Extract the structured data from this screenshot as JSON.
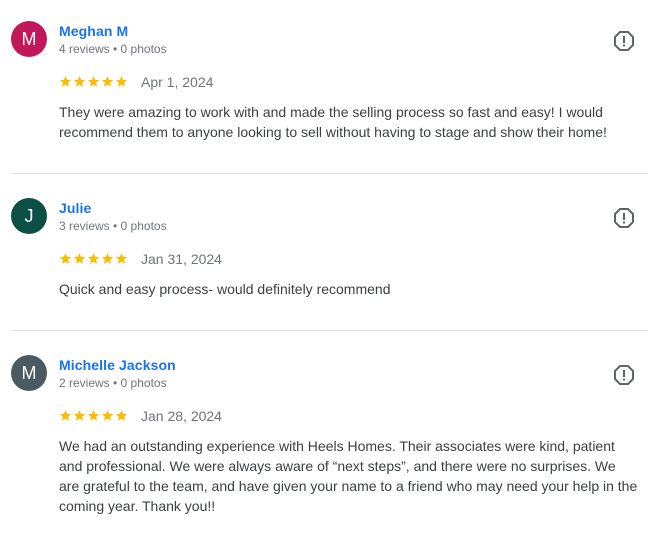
{
  "reviews": [
    {
      "initial": "M",
      "avatar_color": "#c2185b",
      "name": "Meghan M",
      "meta": "4 reviews • 0 photos",
      "rating": 5,
      "date": "Apr 1, 2024",
      "text": "They were amazing to work with and made the selling process so fast and easy! I would recommend them to anyone looking to sell without having to stage and show their home!"
    },
    {
      "initial": "J",
      "avatar_color": "#0b4f45",
      "name": "Julie",
      "meta": "3 reviews • 0 photos",
      "rating": 5,
      "date": "Jan 31, 2024",
      "text": "Quick and easy process- would definitely recommend"
    },
    {
      "initial": "M",
      "avatar_color": "#4b5962",
      "name": "Michelle Jackson",
      "meta": "2 reviews • 0 photos",
      "rating": 5,
      "date": "Jan 28, 2024",
      "text": "We had an outstanding experience with Heels Homes. Their associates were kind, patient and professional. We were always aware of “next steps”, and there were no surprises. We are grateful to the team, and have given your name to a friend who may need your help in the coming year. Thank you!!"
    }
  ],
  "colors": {
    "star": "#fbbc04",
    "link": "#1a73e8",
    "muted": "#70757a",
    "icon": "#5f6368"
  },
  "icons": {
    "flag": "report-icon",
    "star": "star-icon"
  }
}
